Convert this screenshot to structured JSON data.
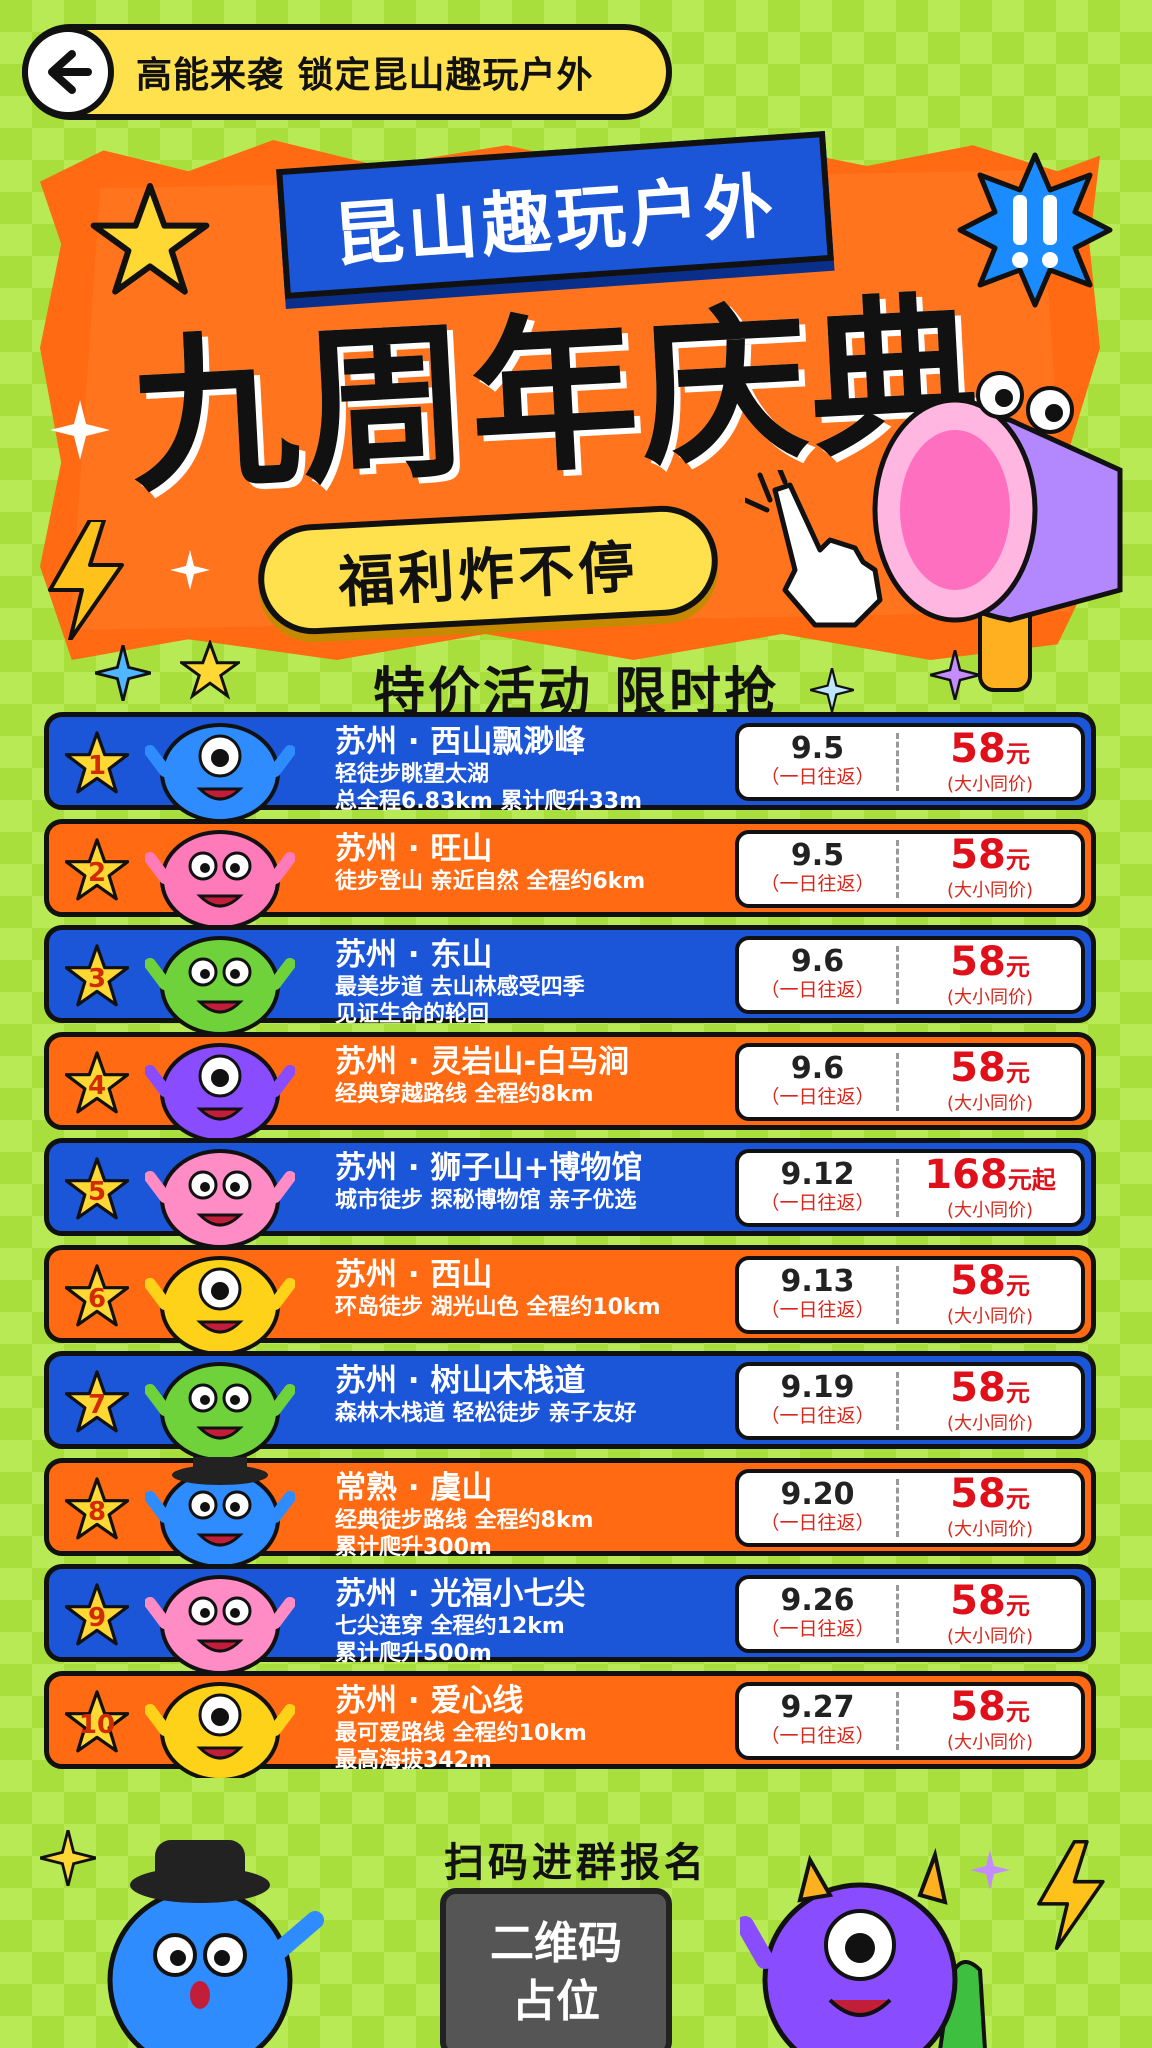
{
  "nav": {
    "title": "高能来袭 锁定昆山趣玩户外",
    "back_icon": "arrow-left-icon"
  },
  "hero": {
    "ribbon": "昆山趣玩户外",
    "title": "九周年庆典",
    "welfare": "福利炸不停",
    "subtitle": "特价活动 限时抢"
  },
  "colors": {
    "background": "#a8df3c",
    "hero_orange": "#ff6a12",
    "ribbon_blue": "#1b55d8",
    "pill_yellow": "#ffe14d",
    "price_red": "#e0101a"
  },
  "activities": [
    {
      "num": "1",
      "route": "苏州 · 西山飘渺峰",
      "desc": [
        "轻徒步眺望太湖",
        "总全程6.83km 累计爬升33m"
      ],
      "date": "9.5",
      "trip": "（一日往返）",
      "price": "58",
      "unit": "元",
      "note": "(大小同价)",
      "color": "blue",
      "mascot": "blue-one-eyed-monster"
    },
    {
      "num": "2",
      "route": "苏州 · 旺山",
      "desc": [
        "徒步登山 亲近自然 全程约6km"
      ],
      "date": "9.5",
      "trip": "（一日往返）",
      "price": "58",
      "unit": "元",
      "note": "(大小同价)",
      "color": "orange",
      "mascot": "pink-monster"
    },
    {
      "num": "3",
      "route": "苏州 · 东山",
      "desc": [
        "最美步道 去山林感受四季",
        "见证生命的轮回"
      ],
      "date": "9.6",
      "trip": "（一日往返）",
      "price": "58",
      "unit": "元",
      "note": "(大小同价)",
      "color": "blue",
      "mascot": "green-monster"
    },
    {
      "num": "4",
      "route": "苏州 · 灵岩山-白马涧",
      "desc": [
        "经典穿越路线 全程约8km"
      ],
      "date": "9.6",
      "trip": "（一日往返）",
      "price": "58",
      "unit": "元",
      "note": "(大小同价)",
      "color": "orange",
      "mascot": "purple-one-eyed-monster"
    },
    {
      "num": "5",
      "route": "苏州 · 狮子山+博物馆",
      "desc": [
        "城市徒步 探秘博物馆 亲子优选"
      ],
      "date": "9.12",
      "trip": "（一日往返）",
      "price": "168",
      "unit": "元起",
      "note": "(大小同价)",
      "color": "blue",
      "mascot": "pink-winking-monster"
    },
    {
      "num": "6",
      "route": "苏州 · 西山",
      "desc": [
        "环岛徒步 湖光山色 全程约10km"
      ],
      "date": "9.13",
      "trip": "（一日往返）",
      "price": "58",
      "unit": "元",
      "note": "(大小同价)",
      "color": "orange",
      "mascot": "yellow-one-eyed-monster"
    },
    {
      "num": "7",
      "route": "苏州 · 树山木栈道",
      "desc": [
        "森林木栈道 轻松徒步 亲子友好"
      ],
      "date": "9.19",
      "trip": "（一日往返）",
      "price": "58",
      "unit": "元",
      "note": "(大小同价)",
      "color": "blue",
      "mascot": "green-monster"
    },
    {
      "num": "8",
      "route": "常熟 · 虞山",
      "desc": [
        "经典徒步路线 全程约8km",
        "累计爬升300m"
      ],
      "date": "9.20",
      "trip": "（一日往返）",
      "price": "58",
      "unit": "元",
      "note": "(大小同价)",
      "color": "orange",
      "mascot": "blue-hat-monster"
    },
    {
      "num": "9",
      "route": "苏州 · 光福小七尖",
      "desc": [
        "七尖连穿 全程约12km",
        "累计爬升500m"
      ],
      "date": "9.26",
      "trip": "（一日往返）",
      "price": "58",
      "unit": "元",
      "note": "(大小同价)",
      "color": "blue",
      "mascot": "pink-winking-monster"
    },
    {
      "num": "10",
      "route": "苏州 · 爱心线",
      "desc": [
        "最可爱路线 全程约10km",
        "最高海拔342m"
      ],
      "date": "9.27",
      "trip": "（一日往返）",
      "price": "58",
      "unit": "元",
      "note": "(大小同价)",
      "color": "orange",
      "mascot": "yellow-one-eyed-monster"
    }
  ],
  "footer": {
    "scan_title": "扫码进群报名",
    "qr_line1": "二维码",
    "qr_line2": "占位"
  }
}
